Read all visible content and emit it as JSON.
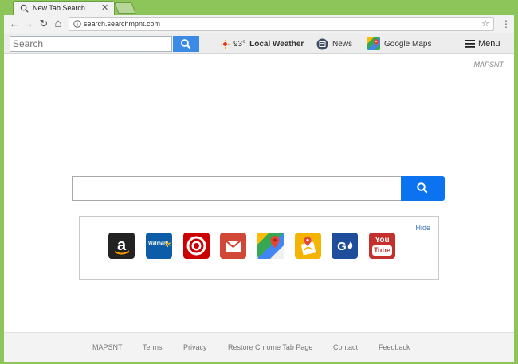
{
  "browser": {
    "tab_title": "New Tab Search",
    "tab_close": "✕",
    "url": "search.searchmpnt.com",
    "back_glyph": "←",
    "forward_glyph": "→",
    "reload_glyph": "↻",
    "home_glyph": "⌂",
    "star_glyph": "☆",
    "menu_glyph": "⋮"
  },
  "extension_bar": {
    "search_placeholder": "Search",
    "weather_temp": "93°",
    "weather_label": "Local Weather",
    "news_label": "News",
    "maps_label": "Google Maps",
    "menu_label": "Menu"
  },
  "brand": "MAPSNT",
  "shortcuts": {
    "hide_label": "Hide",
    "walmart_text": "Walmart",
    "youtube_text_1": "You",
    "youtube_text_2": "Tube"
  },
  "footer": {
    "links": [
      "MAPSNT",
      "Terms",
      "Privacy",
      "Restore Chrome Tab Page",
      "Contact",
      "Feedback"
    ]
  },
  "colors": {
    "frame_green": "#8dc55b",
    "search_blue": "#0b72f0",
    "ext_search_blue": "#3b8ae5",
    "link_blue": "#3a73b5"
  }
}
